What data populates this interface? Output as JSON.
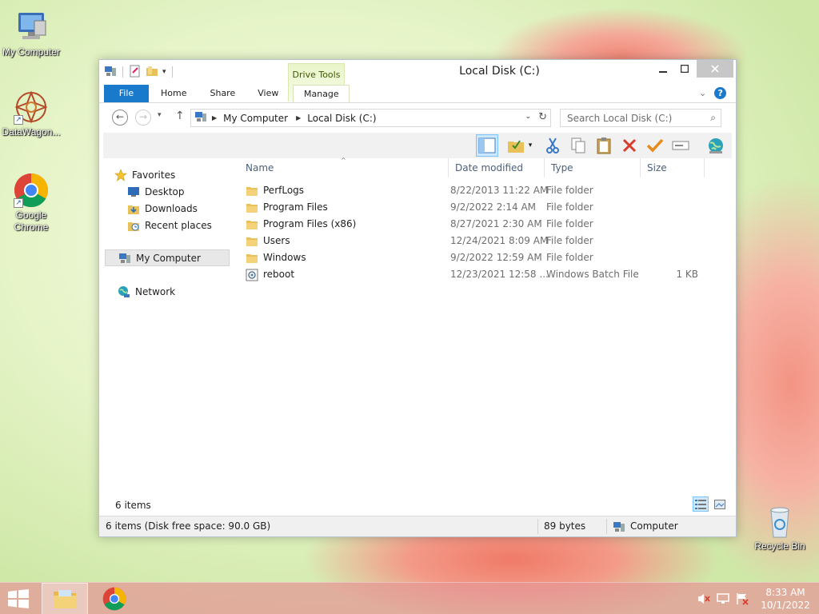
{
  "desktop": {
    "icons": [
      {
        "label": "My Computer"
      },
      {
        "label": "DataWagon..."
      },
      {
        "label": "Google Chrome"
      },
      {
        "label": "Recycle Bin"
      }
    ]
  },
  "window": {
    "title": "Local Disk (C:)",
    "context_tab_group": "Drive Tools",
    "tabs": [
      "File",
      "Home",
      "Share",
      "View",
      "Manage"
    ],
    "address": {
      "crumbs": [
        "My Computer",
        "Local Disk (C:)"
      ]
    },
    "search": {
      "placeholder": "Search Local Disk (C:)"
    },
    "nav_pane": {
      "favorites": "Favorites",
      "items": [
        "Desktop",
        "Downloads",
        "Recent places"
      ],
      "computer": "My Computer",
      "network": "Network"
    },
    "columns": {
      "name": "Name",
      "date": "Date modified",
      "type": "Type",
      "size": "Size"
    },
    "files": [
      {
        "name": "PerfLogs",
        "date": "8/22/2013 11:22 AM",
        "type": "File folder",
        "size": "",
        "kind": "folder"
      },
      {
        "name": "Program Files",
        "date": "9/2/2022 2:14 AM",
        "type": "File folder",
        "size": "",
        "kind": "folder"
      },
      {
        "name": "Program Files (x86)",
        "date": "8/27/2021 2:30 AM",
        "type": "File folder",
        "size": "",
        "kind": "folder"
      },
      {
        "name": "Users",
        "date": "12/24/2021 8:09 AM",
        "type": "File folder",
        "size": "",
        "kind": "folder"
      },
      {
        "name": "Windows",
        "date": "9/2/2022 12:59 AM",
        "type": "File folder",
        "size": "",
        "kind": "folder"
      },
      {
        "name": "reboot",
        "date": "12/23/2021 12:58 ...",
        "type": "Windows Batch File",
        "size": "1 KB",
        "kind": "batch"
      }
    ],
    "item_count": "6 items",
    "status": {
      "left": "6 items (Disk free space: 90.0 GB)",
      "bytes": "89 bytes",
      "location": "Computer"
    }
  },
  "taskbar": {
    "time": "8:33 AM",
    "date": "10/1/2022"
  },
  "colors": {
    "accent": "#1979ca",
    "selection": "#cce8ff",
    "folder": "#e8c15a"
  }
}
